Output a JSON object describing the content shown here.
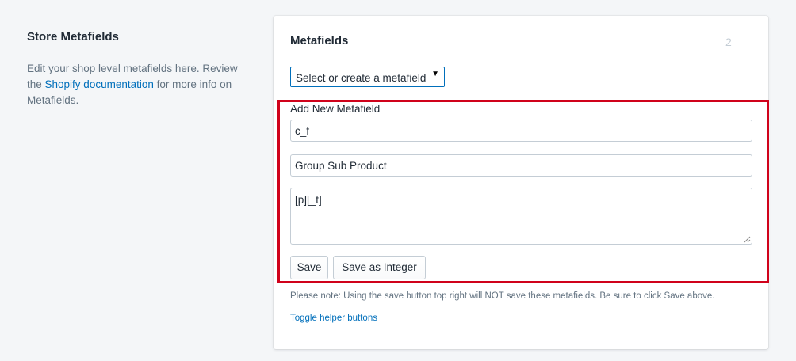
{
  "section": {
    "title": "Store Metafields",
    "desc_prefix": "Edit your shop level metafields here. Review the ",
    "link_text": "Shopify documentation",
    "desc_suffix": " for more info on Metafields."
  },
  "card": {
    "title": "Metafields",
    "count": "2",
    "select_value": "Select or create a metafield",
    "new_label": "Add New Metafield",
    "key_value": "c_f",
    "name_value": "Group Sub Product",
    "content_value": "[p][_t]",
    "save_label": "Save",
    "save_integer_label": "Save as Integer",
    "note": "Please note: Using the save button top right will NOT save these metafields. Be sure to click Save above.",
    "toggle_label": "Toggle helper buttons"
  },
  "icons": {
    "select_caret": "caret-down-icon",
    "resize_grip": "resize-grip-icon"
  },
  "colors": {
    "highlight": "#d0021b",
    "link": "#006fbb",
    "background": "#f4f6f8"
  }
}
